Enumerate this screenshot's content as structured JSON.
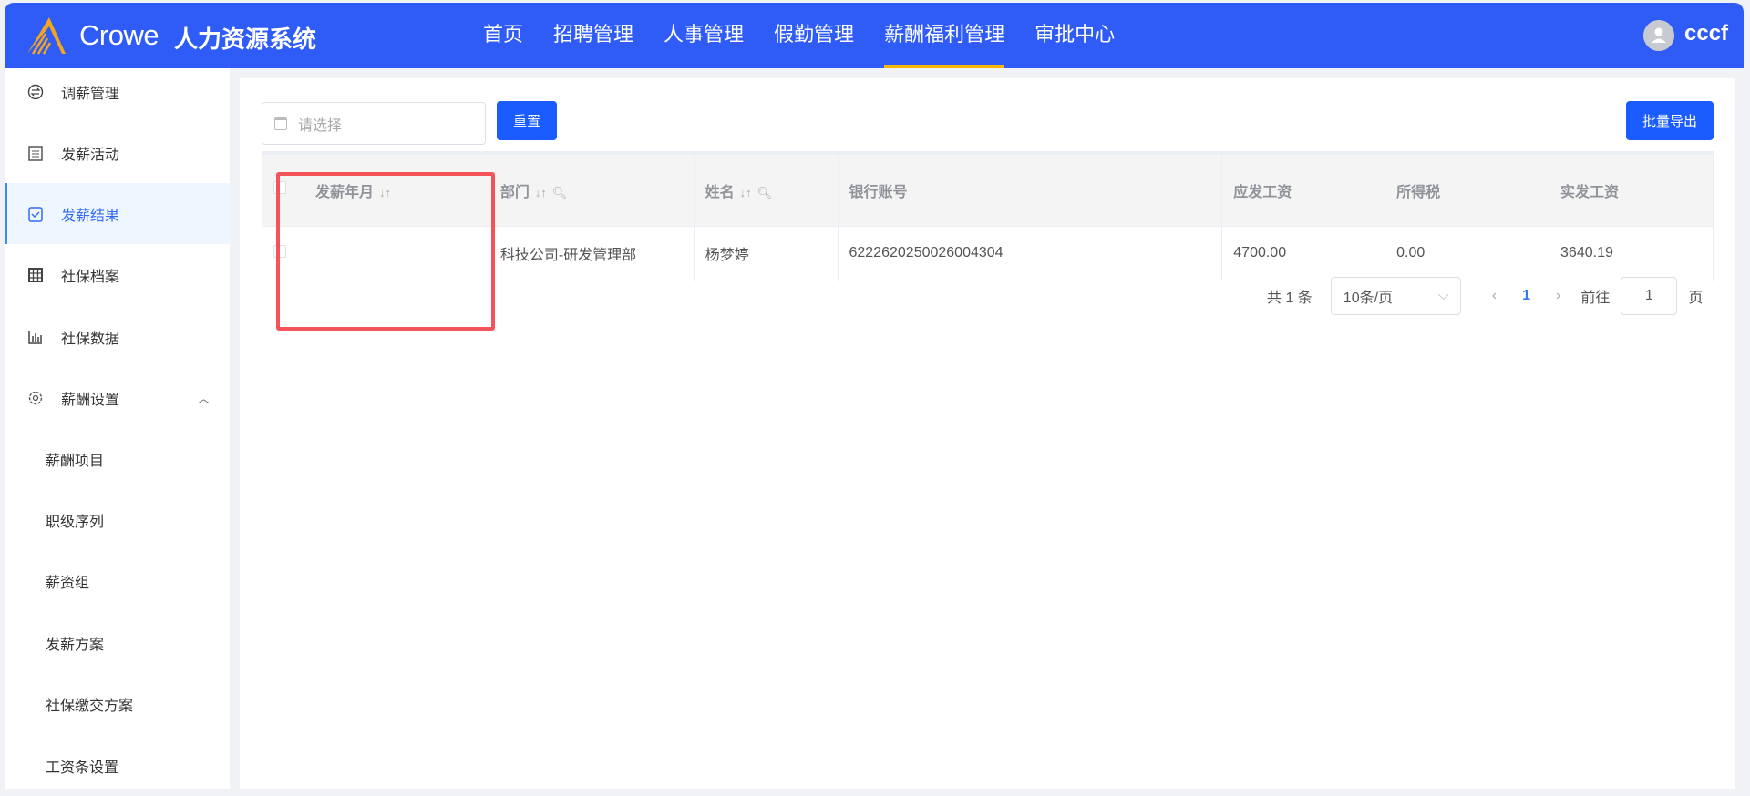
{
  "header": {
    "brand": "Crowe",
    "system": "人力资源系统",
    "user": "cccf",
    "nav": [
      "首页",
      "招聘管理",
      "人事管理",
      "假勤管理",
      "薪酬福利管理",
      "审批中心"
    ],
    "active_nav": "薪酬福利管理"
  },
  "sidebar": {
    "items": [
      {
        "label": "调薪管理",
        "icon": "swap-circle-icon"
      },
      {
        "label": "发薪活动",
        "icon": "clipboard-icon"
      },
      {
        "label": "发薪结果",
        "icon": "clipboard-check-icon",
        "active": true
      },
      {
        "label": "社保档案",
        "icon": "archive-icon"
      },
      {
        "label": "社保数据",
        "icon": "bar-chart-icon"
      },
      {
        "label": "薪酬设置",
        "icon": "gear-icon",
        "expanded": true
      }
    ],
    "sub_items": [
      "薪酬项目",
      "职级序列",
      "薪资组",
      "发薪方案",
      "社保缴交方案",
      "工资条设置"
    ]
  },
  "filter": {
    "date_placeholder": "请选择",
    "reset_label": "重置",
    "export_label": "批量导出"
  },
  "table": {
    "columns": [
      "发薪年月",
      "部门",
      "姓名",
      "银行账号",
      "应发工资",
      "所得税",
      "实发工资"
    ],
    "rows": [
      {
        "month": "",
        "dept": "科技公司-研发管理部",
        "name": "杨梦婷",
        "account": "6222620250026004304",
        "gross": "4700.00",
        "tax": "0.00",
        "net": "3640.19"
      }
    ]
  },
  "pagination": {
    "total": "共 1 条",
    "page_size": "10条/页",
    "current": "1",
    "goto_label": "前往",
    "goto_value": "1",
    "page_suffix": "页"
  },
  "colors": {
    "header": "#2f5cf6",
    "primary": "#1a5cff",
    "highlight_box": "#f4535a",
    "nav_underline": "#f5b800"
  }
}
